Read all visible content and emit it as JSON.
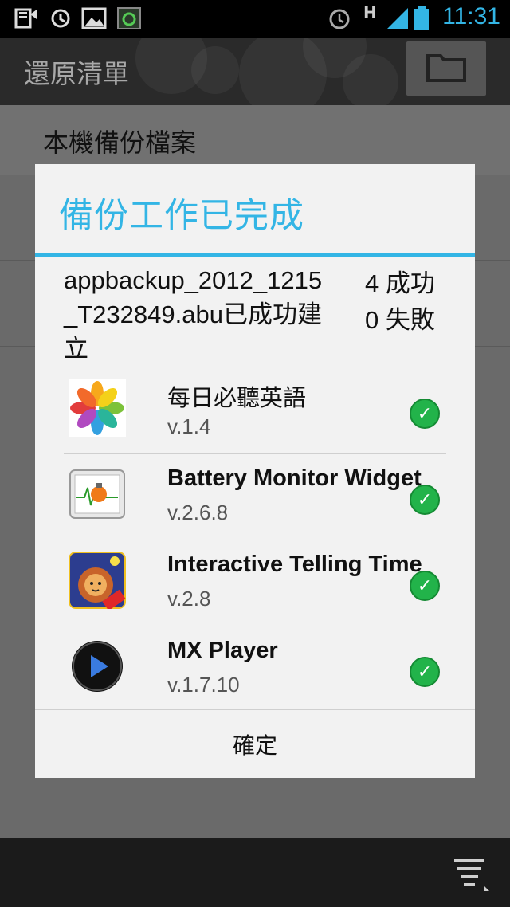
{
  "status_bar": {
    "time": "11:31",
    "network": "H",
    "icons": [
      "sdcard-icon",
      "sync-icon",
      "image-icon",
      "app-update-icon",
      "alarm-icon",
      "signal-icon",
      "battery-icon"
    ]
  },
  "action_bar": {
    "title": "還原清單",
    "folder_icon": "folder-icon"
  },
  "page": {
    "section_label": "本機備份檔案"
  },
  "dialog": {
    "title": "備份工作已完成",
    "message": "appbackup_2012_1215_T232849.abu已成功建立",
    "success_count": "4 成功",
    "fail_count": "0 失敗",
    "apps": [
      {
        "name": "每日必聽英語",
        "version": "v.1.4",
        "icon": "flower-icon"
      },
      {
        "name": "Battery Monitor Widget",
        "version": "v.2.6.8",
        "icon": "battery-monitor-icon"
      },
      {
        "name": "Interactive Telling Time",
        "version": "v.2.8",
        "icon": "lion-clock-icon"
      },
      {
        "name": "MX Player",
        "version": "v.1.7.10",
        "icon": "play-icon"
      }
    ],
    "ok_label": "確定"
  },
  "colors": {
    "accent": "#33b5e5",
    "check": "#22b34a"
  }
}
